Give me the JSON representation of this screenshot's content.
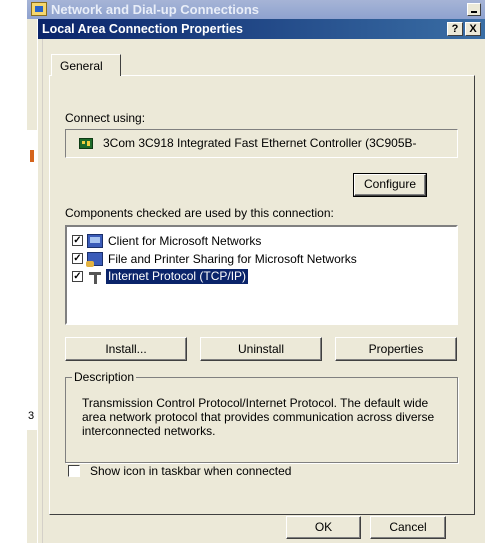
{
  "background_window": {
    "title": "Network and Dial-up Connections",
    "strip_number": "3"
  },
  "dialog": {
    "title": "Local Area Connection Properties",
    "help_label": "?",
    "close_label": "X",
    "tabs": [
      {
        "label": "General"
      }
    ],
    "connect_using_label": "Connect using:",
    "adapter_name": "3Com 3C918 Integrated Fast Ethernet Controller (3C905B-",
    "configure_label": "Configure",
    "components_label": "Components checked are used by this connection:",
    "components": [
      {
        "label": "Client for Microsoft Networks",
        "checked": true,
        "icon": "client-network-icon",
        "selected": false
      },
      {
        "label": "File and Printer Sharing for Microsoft Networks",
        "checked": true,
        "icon": "file-printer-sharing-icon",
        "selected": false
      },
      {
        "label": "Internet Protocol (TCP/IP)",
        "checked": true,
        "icon": "network-protocol-icon",
        "selected": true
      }
    ],
    "install_label": "Install...",
    "uninstall_label": "Uninstall",
    "properties_label": "Properties",
    "description_legend": "Description",
    "description_text": "Transmission Control Protocol/Internet Protocol. The default wide area network protocol that provides communication across diverse interconnected networks.",
    "show_icon_label": "Show icon in taskbar when connected",
    "show_icon_checked": false,
    "ok_label": "OK",
    "cancel_label": "Cancel"
  },
  "colors": {
    "title_active": "#0a246a",
    "face": "#ece9d8",
    "selection": "#0a246a"
  }
}
